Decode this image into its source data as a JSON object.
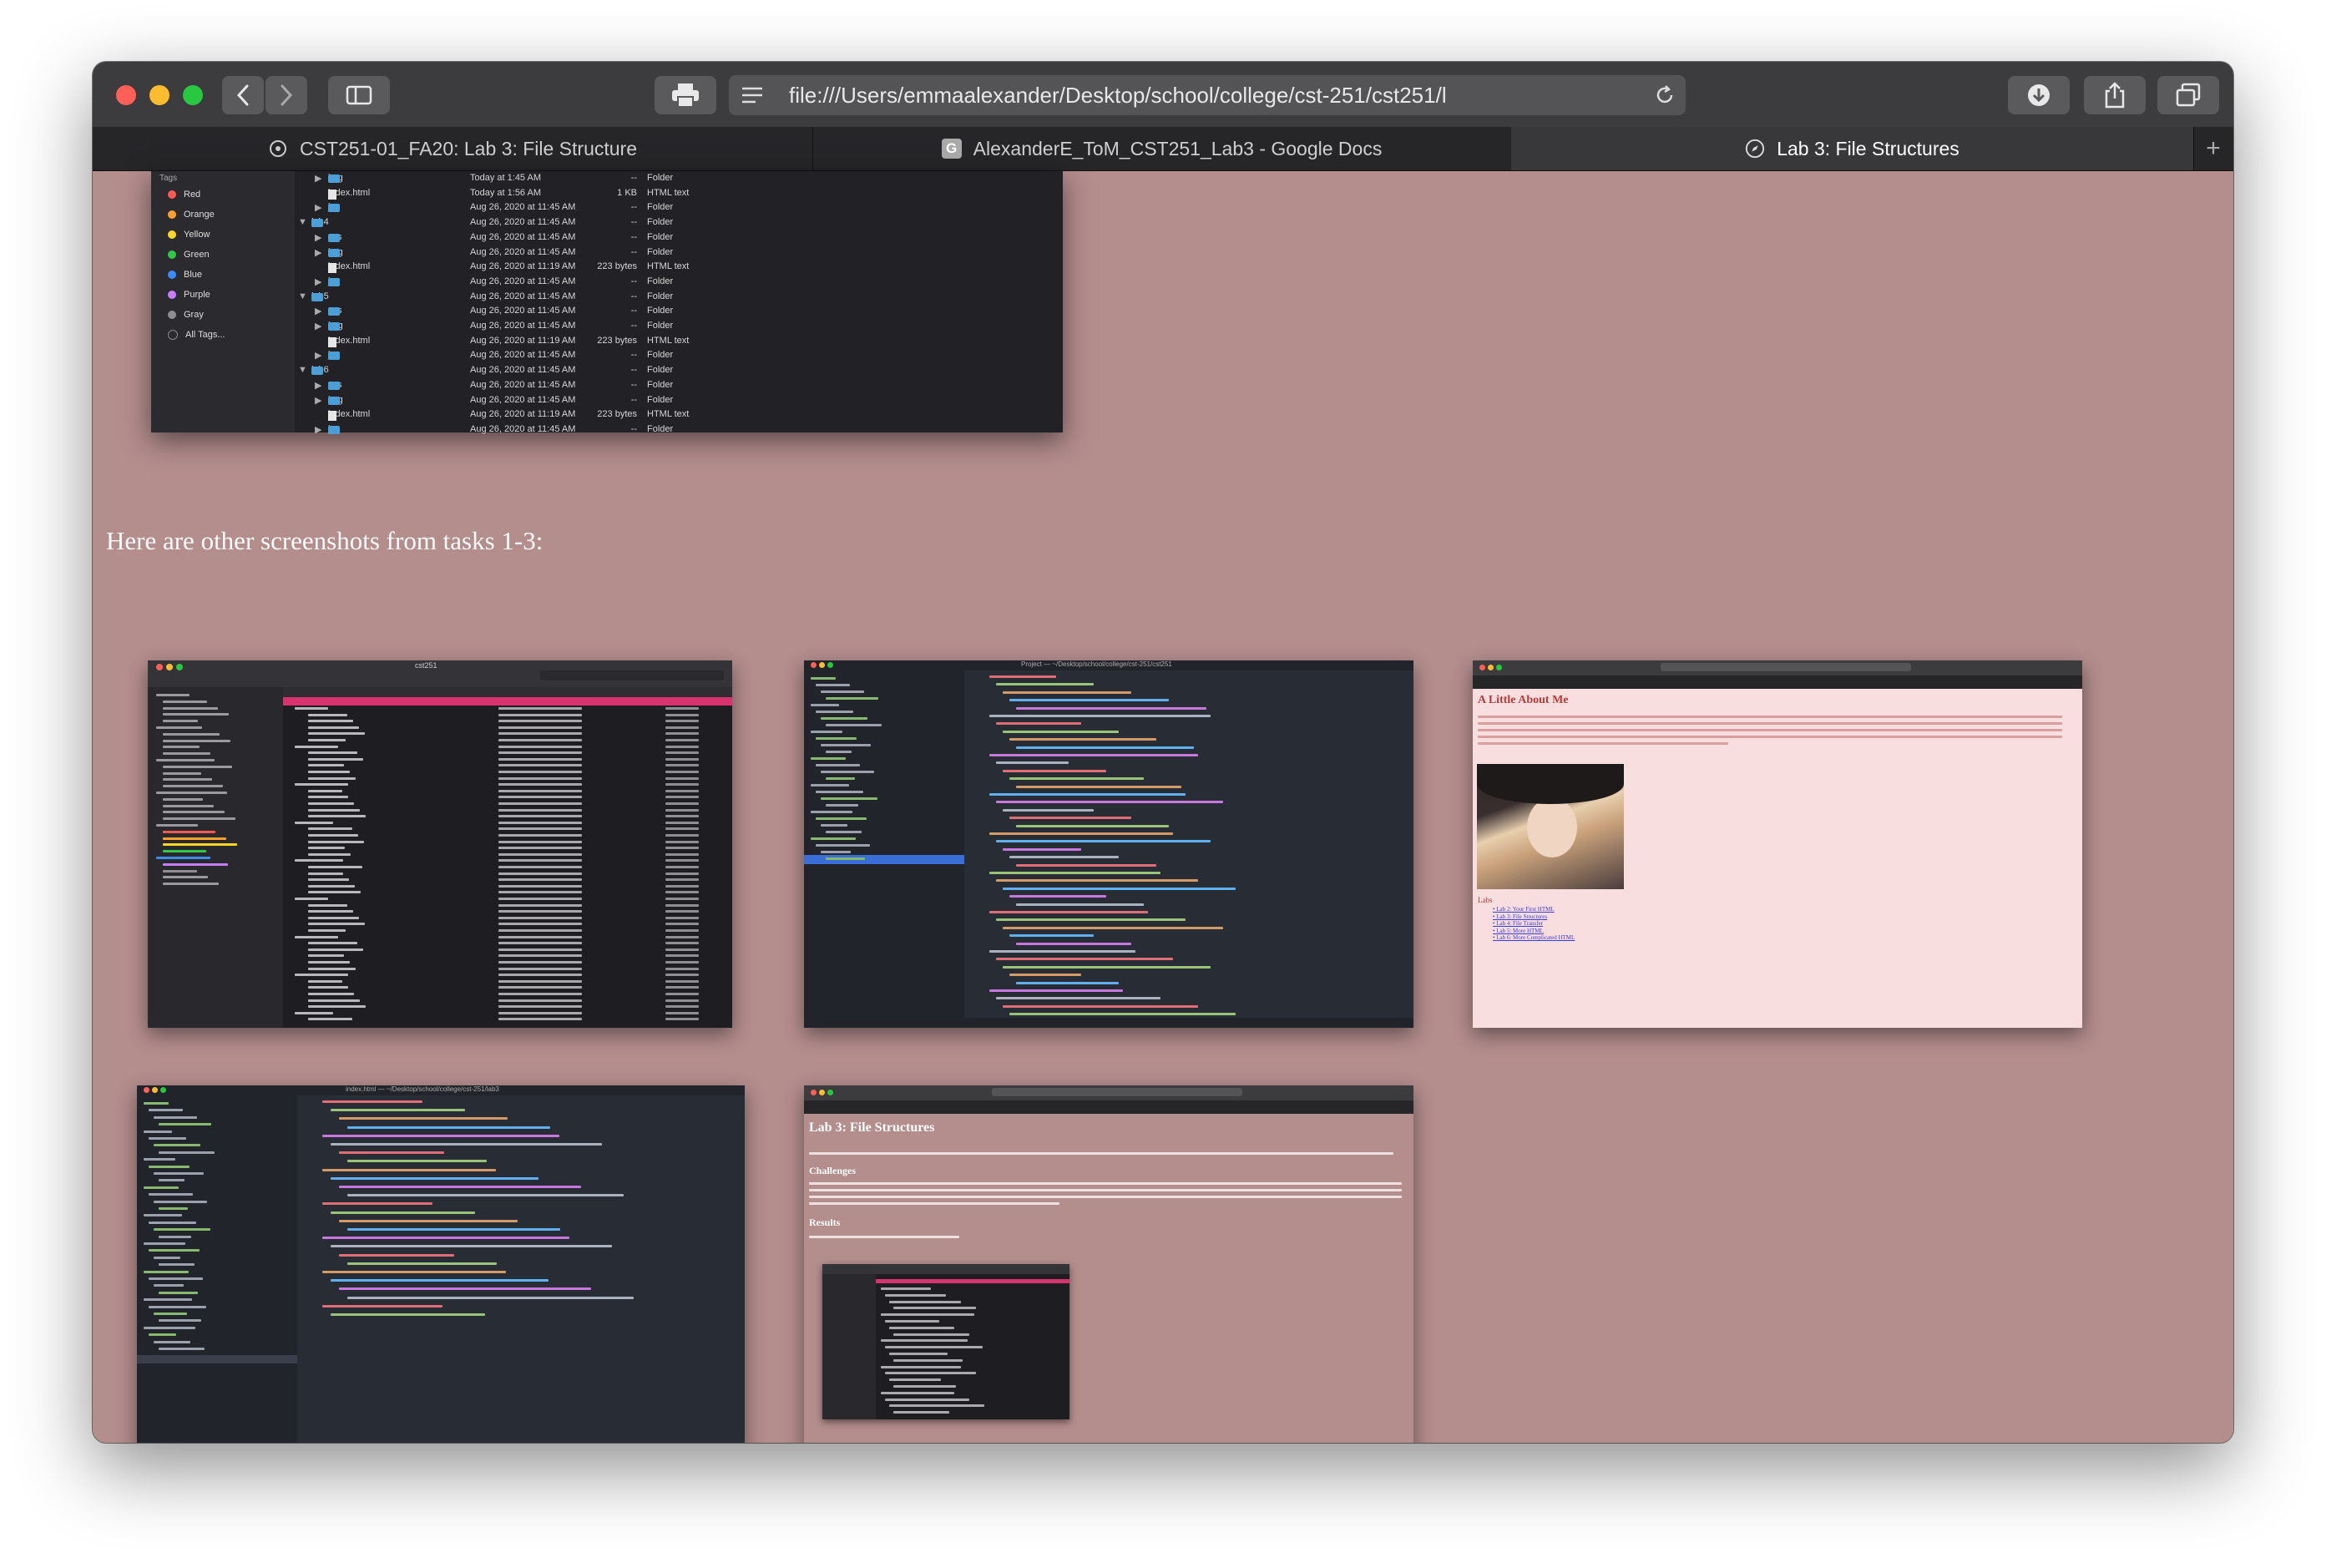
{
  "browser": {
    "url": "file:///Users/emmaalexander/Desktop/school/college/cst-251/cst251/l",
    "tabs": [
      {
        "label": "CST251-01_FA20: Lab 3: File Structure",
        "icon": "canvas-logo-icon"
      },
      {
        "label": "AlexanderE_ToM_CST251_Lab3 - Google Docs",
        "icon": "google-docs-icon"
      },
      {
        "label": "Lab 3: File Structures",
        "icon": "compass-icon"
      }
    ],
    "new_tab_label": "+"
  },
  "finder": {
    "sidebar_heading": "Tags",
    "tags": [
      {
        "label": "Red",
        "color": "#ff5a52"
      },
      {
        "label": "Orange",
        "color": "#ff9f2e"
      },
      {
        "label": "Yellow",
        "color": "#ffd426"
      },
      {
        "label": "Green",
        "color": "#33c748"
      },
      {
        "label": "Blue",
        "color": "#3b8bff"
      },
      {
        "label": "Purple",
        "color": "#c77dff"
      },
      {
        "label": "Gray",
        "color": "#8e8e93"
      },
      {
        "label": "All Tags...",
        "color": "#555555"
      }
    ],
    "rows": [
      {
        "name": "img",
        "date": "Today at 1:45 AM",
        "size": "--",
        "kind": "Folder",
        "type": "folder",
        "indent": 1,
        "tri": "▶"
      },
      {
        "name": "index.html",
        "date": "Today at 1:56 AM",
        "size": "1 KB",
        "kind": "HTML text",
        "type": "file",
        "indent": 1,
        "tri": ""
      },
      {
        "name": "js",
        "date": "Aug 26, 2020 at 11:45 AM",
        "size": "--",
        "kind": "Folder",
        "type": "folder",
        "indent": 1,
        "tri": "▶"
      },
      {
        "name": "lab4",
        "date": "Aug 26, 2020 at 11:45 AM",
        "size": "--",
        "kind": "Folder",
        "type": "folder",
        "indent": 0,
        "tri": "▼"
      },
      {
        "name": "css",
        "date": "Aug 26, 2020 at 11:45 AM",
        "size": "--",
        "kind": "Folder",
        "type": "folder",
        "indent": 1,
        "tri": "▶"
      },
      {
        "name": "img",
        "date": "Aug 26, 2020 at 11:45 AM",
        "size": "--",
        "kind": "Folder",
        "type": "folder",
        "indent": 1,
        "tri": "▶"
      },
      {
        "name": "index.html",
        "date": "Aug 26, 2020 at 11:19 AM",
        "size": "223 bytes",
        "kind": "HTML text",
        "type": "file",
        "indent": 1,
        "tri": ""
      },
      {
        "name": "js",
        "date": "Aug 26, 2020 at 11:45 AM",
        "size": "--",
        "kind": "Folder",
        "type": "folder",
        "indent": 1,
        "tri": "▶"
      },
      {
        "name": "lab5",
        "date": "Aug 26, 2020 at 11:45 AM",
        "size": "--",
        "kind": "Folder",
        "type": "folder",
        "indent": 0,
        "tri": "▼"
      },
      {
        "name": "css",
        "date": "Aug 26, 2020 at 11:45 AM",
        "size": "--",
        "kind": "Folder",
        "type": "folder",
        "indent": 1,
        "tri": "▶"
      },
      {
        "name": "img",
        "date": "Aug 26, 2020 at 11:45 AM",
        "size": "--",
        "kind": "Folder",
        "type": "folder",
        "indent": 1,
        "tri": "▶"
      },
      {
        "name": "index.html",
        "date": "Aug 26, 2020 at 11:19 AM",
        "size": "223 bytes",
        "kind": "HTML text",
        "type": "file",
        "indent": 1,
        "tri": ""
      },
      {
        "name": "js",
        "date": "Aug 26, 2020 at 11:45 AM",
        "size": "--",
        "kind": "Folder",
        "type": "folder",
        "indent": 1,
        "tri": "▶"
      },
      {
        "name": "lab6",
        "date": "Aug 26, 2020 at 11:45 AM",
        "size": "--",
        "kind": "Folder",
        "type": "folder",
        "indent": 0,
        "tri": "▼"
      },
      {
        "name": "css",
        "date": "Aug 26, 2020 at 11:45 AM",
        "size": "--",
        "kind": "Folder",
        "type": "folder",
        "indent": 1,
        "tri": "▶"
      },
      {
        "name": "img",
        "date": "Aug 26, 2020 at 11:45 AM",
        "size": "--",
        "kind": "Folder",
        "type": "folder",
        "indent": 1,
        "tri": "▶"
      },
      {
        "name": "index.html",
        "date": "Aug 26, 2020 at 11:19 AM",
        "size": "223 bytes",
        "kind": "HTML text",
        "type": "file",
        "indent": 1,
        "tri": ""
      },
      {
        "name": "js",
        "date": "Aug 26, 2020 at 11:45 AM",
        "size": "--",
        "kind": "Folder",
        "type": "folder",
        "indent": 1,
        "tri": "▶"
      }
    ]
  },
  "page": {
    "caption": "Here are other screenshots from tasks 1-3:"
  },
  "thumbnails": {
    "finder_title": "cst251",
    "editor_title": "Project — ~/Desktop/school/college/cst-251/cst251",
    "editor2_title": "index.html — ~/Desktop/school/college/cst-251/lab3",
    "about": {
      "heading": "A Little About Me",
      "labs_heading": "Labs",
      "links": [
        "Lab 2: Your First HTML",
        "Lab 3: File Structures",
        "Lab 4: File Transfer",
        "Lab 5: More HTML",
        "Lab 6: More Complicated HTML"
      ]
    },
    "lab3": {
      "heading": "Lab 3: File Structures",
      "challenges": "Challenges",
      "results": "Results"
    }
  },
  "colors": {
    "page_bg": "#b48d8d",
    "titlebar": "#3c3b3e",
    "finder_highlight": "#d8336f"
  }
}
